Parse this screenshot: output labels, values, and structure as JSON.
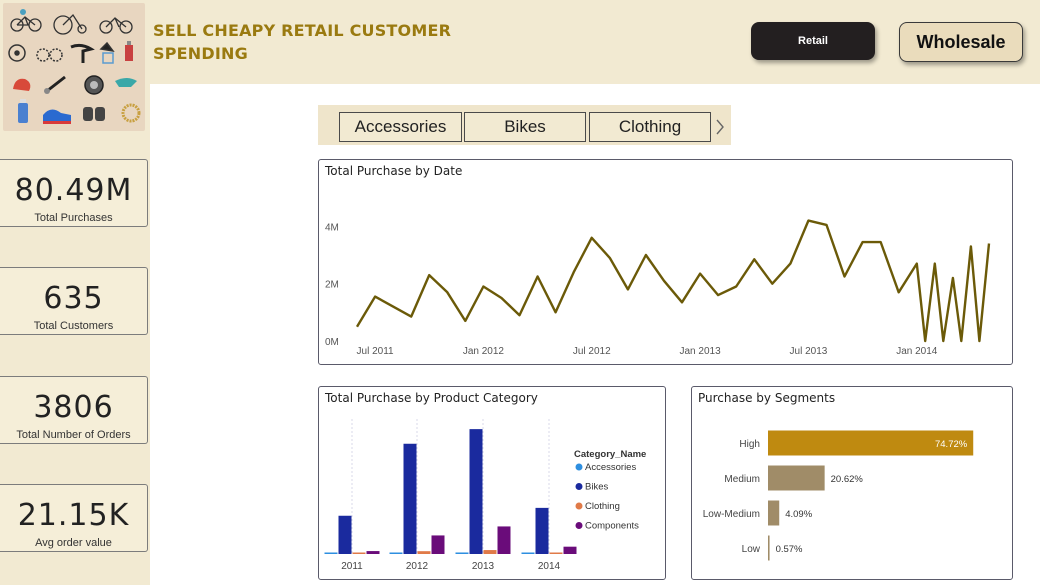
{
  "header": {
    "title_line1": "SELL CHEAPY RETAIL CUSTOMER",
    "title_line2": "SPENDING",
    "retail_button": "Retail",
    "wholesale_button": "Wholesale"
  },
  "kpis": [
    {
      "value": "80.49M",
      "label": "Total Purchases"
    },
    {
      "value": "635",
      "label": "Total Customers"
    },
    {
      "value": "3806",
      "label": "Total Number of Orders"
    },
    {
      "value": "21.15K",
      "label": "Avg order value"
    }
  ],
  "slicer": {
    "items": [
      "Accessories",
      "Bikes",
      "Clothing"
    ]
  },
  "colors": {
    "background_panel": "#f2ead2",
    "title": "#9a7a10",
    "line": "#6b5a08",
    "accessories": "#2e8fe0",
    "bikes": "#1a2a9e",
    "clothing": "#e07a48",
    "components": "#6a0c7a",
    "seg_high": "#bf8a10",
    "seg_other": "#a08c68"
  },
  "chart_data": [
    {
      "type": "line",
      "title": "Total Purchase by Date",
      "x_tick_labels": [
        "Jul 2011",
        "Jan 2012",
        "Jul 2012",
        "Jan 2013",
        "Jul 2013",
        "Jan 2014"
      ],
      "y_tick_labels": [
        "0M",
        "2M",
        "4M"
      ],
      "ylim": [
        0,
        4500000
      ],
      "x": [
        "2011-06",
        "2011-07",
        "2011-08",
        "2011-09",
        "2011-10",
        "2011-11",
        "2011-12",
        "2012-01",
        "2012-02",
        "2012-03",
        "2012-04",
        "2012-05",
        "2012-06",
        "2012-07",
        "2012-08",
        "2012-09",
        "2012-10",
        "2012-11",
        "2012-12",
        "2013-01",
        "2013-02",
        "2013-03",
        "2013-04",
        "2013-05",
        "2013-06",
        "2013-07",
        "2013-08",
        "2013-09",
        "2013-10",
        "2013-11",
        "2013-12",
        "2014-01",
        "2014-01-15",
        "2014-01-31",
        "2014-02-15",
        "2014-03-01",
        "2014-03-15",
        "2014-04-01",
        "2014-04-15",
        "2014-05-01"
      ],
      "values": [
        500000,
        1550000,
        1200000,
        850000,
        2300000,
        1700000,
        700000,
        1900000,
        1500000,
        900000,
        2250000,
        1000000,
        2400000,
        3600000,
        2900000,
        1800000,
        3000000,
        2100000,
        1350000,
        2350000,
        1600000,
        1900000,
        2850000,
        2000000,
        2700000,
        4200000,
        4050000,
        2250000,
        3450000,
        3450000,
        1700000,
        2700000,
        0,
        2700000,
        0,
        2200000,
        0,
        3300000,
        0,
        3400000
      ]
    },
    {
      "type": "bar",
      "title": "Total Purchase by Product Category",
      "legend_title": "Category_Name",
      "categories": [
        "2011",
        "2012",
        "2013",
        "2014"
      ],
      "series": [
        {
          "name": "Accessories",
          "values": [
            20000,
            120000,
            270000,
            110000
          ]
        },
        {
          "name": "Bikes",
          "values": [
            6800000,
            19600000,
            22200000,
            8200000
          ]
        },
        {
          "name": "Clothing",
          "values": [
            70000,
            500000,
            700000,
            190000
          ]
        },
        {
          "name": "Components",
          "values": [
            520000,
            3300000,
            4900000,
            1300000
          ]
        }
      ],
      "ylim": [
        0,
        24000000
      ]
    },
    {
      "type": "bar",
      "title": "Purchase by Segments",
      "categories": [
        "High",
        "Medium",
        "Low-Medium",
        "Low"
      ],
      "values": [
        74.72,
        20.62,
        4.09,
        0.57
      ],
      "value_labels": [
        "74.72%",
        "20.62%",
        "4.09%",
        "0.57%"
      ]
    }
  ]
}
